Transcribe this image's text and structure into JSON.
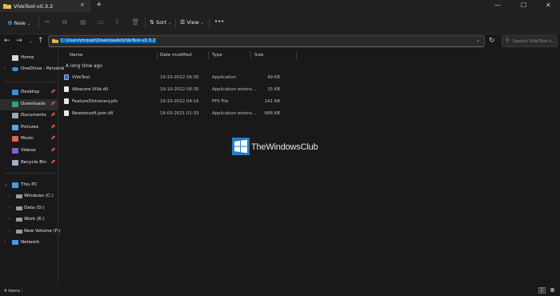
{
  "window": {
    "tab_title": "ViVeTool-v0.3.2",
    "tab_close": "×",
    "new_tab": "+",
    "minimize": "—",
    "maximize": "☐",
    "close": "✕"
  },
  "commandbar": {
    "new_label": "New",
    "sort_label": "Sort",
    "view_label": "View",
    "more_label": "•••"
  },
  "address": {
    "path": "C:\\Users\\mrpab\\Downloads\\ViVeTool-v0.3.2",
    "search_placeholder": "Search ViVeTool-v..."
  },
  "sidebar": {
    "home": "Home",
    "onedrive": "OneDrive - Persona",
    "quick_access": [
      {
        "label": "Desktop",
        "icon": "desktop-icon",
        "color": "#3b8edb"
      },
      {
        "label": "Downloads",
        "icon": "downloads-icon",
        "color": "#2fa86d"
      },
      {
        "label": "Documents",
        "icon": "documents-icon",
        "color": "#9aa7b5"
      },
      {
        "label": "Pictures",
        "icon": "pictures-icon",
        "color": "#5ea6e0"
      },
      {
        "label": "Music",
        "icon": "music-icon",
        "color": "#e0664f"
      },
      {
        "label": "Videos",
        "icon": "videos-icon",
        "color": "#8a5cd1"
      },
      {
        "label": "Recycle Bin",
        "icon": "recycle-bin-icon",
        "color": "#9ab0c4"
      }
    ],
    "this_pc": "This PC",
    "drives": [
      {
        "label": "Windows (C:)"
      },
      {
        "label": "Data (D:)"
      },
      {
        "label": "Work (E:)"
      },
      {
        "label": "New Volume (F:)"
      }
    ],
    "network": "Network"
  },
  "columns": {
    "name": "Name",
    "date": "Date modified",
    "type": "Type",
    "size": "Size"
  },
  "group": {
    "label": "A long time ago"
  },
  "files": [
    {
      "name": "ViVeTool",
      "date": "19-10-2022 06:35",
      "type": "Application",
      "size": "49 KB",
      "icon": "application-icon"
    },
    {
      "name": "Albacore.ViVe.dll",
      "date": "19-10-2022 06:35",
      "type": "Application extens...",
      "size": "15 KB",
      "icon": "dll-file-icon"
    },
    {
      "name": "FeatureDictionary.pfs",
      "date": "19-10-2022 04:16",
      "type": "PFS File",
      "size": "241 KB",
      "icon": "file-icon"
    },
    {
      "name": "Newtonsoft.Json.dll",
      "date": "18-03-2021 01:33",
      "type": "Application extens...",
      "size": "686 KB",
      "icon": "dll-file-icon"
    }
  ],
  "watermark": {
    "text": "TheWindowsClub"
  },
  "status": {
    "item_count": "4 items"
  }
}
